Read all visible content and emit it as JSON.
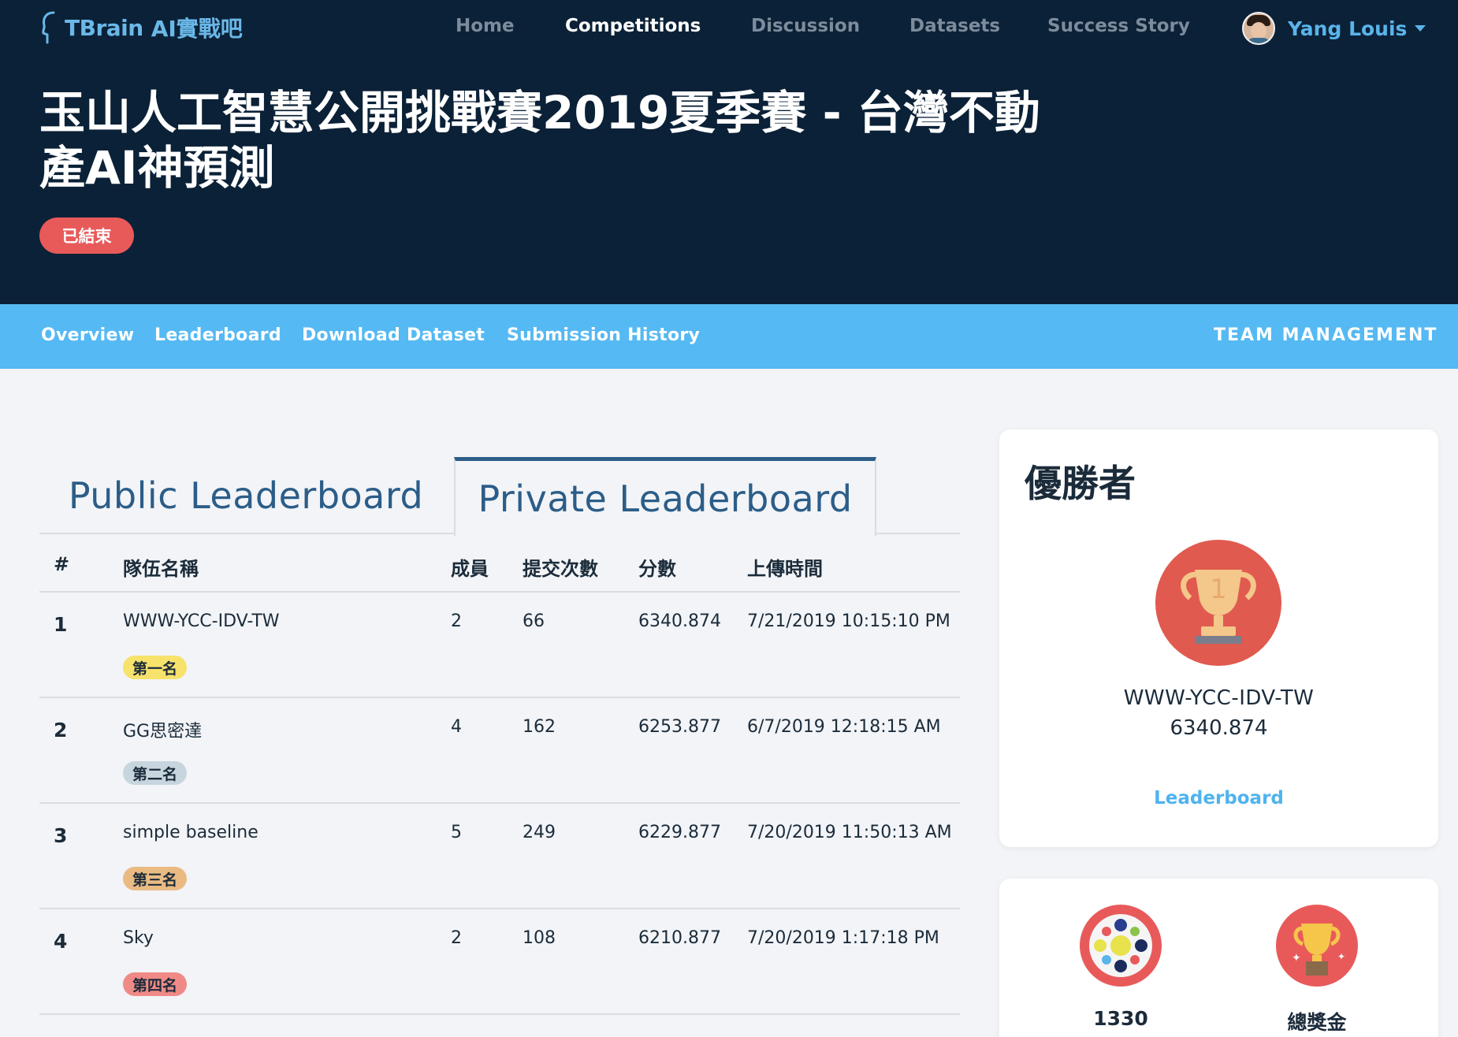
{
  "brand": {
    "logo_text": "TBrain",
    "logo_ai": "AI實戰吧"
  },
  "nav": {
    "items": [
      {
        "label": "Home",
        "active": false
      },
      {
        "label": "Competitions",
        "active": true
      },
      {
        "label": "Discussion",
        "active": false
      },
      {
        "label": "Datasets",
        "active": false
      },
      {
        "label": "Success Story",
        "active": false
      }
    ],
    "user_name": "Yang Louis"
  },
  "competition": {
    "title": "玉山人工智慧公開挑戰賽2019夏季賽 - 台灣不動產AI神預測",
    "status": "已結束"
  },
  "subnav": {
    "items": [
      "Overview",
      "Leaderboard",
      "Download Dataset",
      "Submission History"
    ],
    "team_management": "TEAM MANAGEMENT"
  },
  "leaderboard": {
    "tabs": [
      "Public Leaderboard",
      "Private Leaderboard"
    ],
    "active_tab": "Private Leaderboard",
    "columns": [
      "#",
      "隊伍名稱",
      "成員",
      "提交次數",
      "分數",
      "上傳時間"
    ],
    "rows": [
      {
        "rank": "1",
        "team": "WWW-YCC-IDV-TW",
        "members": "2",
        "submissions": "66",
        "score": "6340.874",
        "time": "7/21/2019 10:15:10 PM",
        "badge": "第一名",
        "badge_color": "#f7e26b"
      },
      {
        "rank": "2",
        "team": "GG思密達",
        "members": "4",
        "submissions": "162",
        "score": "6253.877",
        "time": "6/7/2019 12:18:15 AM",
        "badge": "第二名",
        "badge_color": "#c7d6de"
      },
      {
        "rank": "3",
        "team": "simple baseline",
        "members": "5",
        "submissions": "249",
        "score": "6229.877",
        "time": "7/20/2019 11:50:13 AM",
        "badge": "第三名",
        "badge_color": "#e9bb83"
      },
      {
        "rank": "4",
        "team": "Sky",
        "members": "2",
        "submissions": "108",
        "score": "6210.877",
        "time": "7/20/2019 1:17:18 PM",
        "badge": "第四名",
        "badge_color": "#f08a86"
      }
    ]
  },
  "winner": {
    "heading": "優勝者",
    "team": "WWW-YCC-IDV-TW",
    "score": "6340.874",
    "link": "Leaderboard"
  },
  "stats": {
    "participants": "1330",
    "prize_label": "總獎金"
  }
}
